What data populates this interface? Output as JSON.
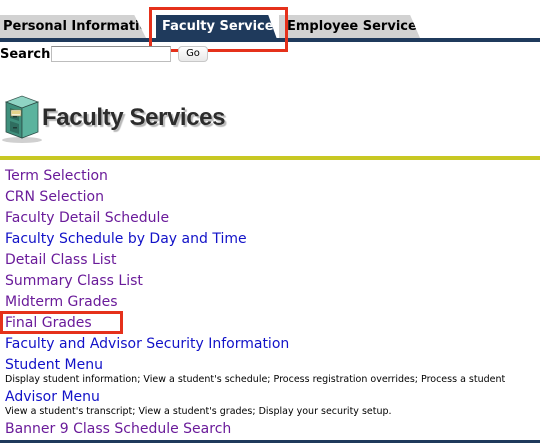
{
  "tabs": {
    "personal": "Personal Information",
    "faculty": "Faculty Services",
    "employee": "Employee Services"
  },
  "search": {
    "label": "Search",
    "value": "",
    "go_label": "Go"
  },
  "page": {
    "title": "Faculty Services",
    "icon": "file-cabinet-icon"
  },
  "menu": {
    "term_selection": "Term Selection",
    "crn_selection": "CRN Selection",
    "faculty_detail_schedule": "Faculty Detail Schedule",
    "faculty_schedule_day_time": "Faculty Schedule by Day and Time",
    "detail_class_list": "Detail Class List",
    "summary_class_list": "Summary Class List",
    "midterm_grades": "Midterm Grades",
    "final_grades": "Final Grades",
    "security_info": "Faculty and Advisor Security Information",
    "student_menu": "Student Menu",
    "student_menu_desc": "Display student information; View a student's schedule; Process registration overrides; Process a student",
    "advisor_menu": "Advisor Menu",
    "advisor_menu_desc": "View a student's transcript; View a student's grades; Display your security setup.",
    "banner9_search": "Banner 9 Class Schedule Search"
  },
  "colors": {
    "tab_active": "#1f3a5c",
    "tab_inactive": "#d2d2d2",
    "rule_accent": "#c8c823",
    "link_visited": "#6a1b9a",
    "link_new": "#1212c8",
    "highlight": "#e5311b"
  }
}
